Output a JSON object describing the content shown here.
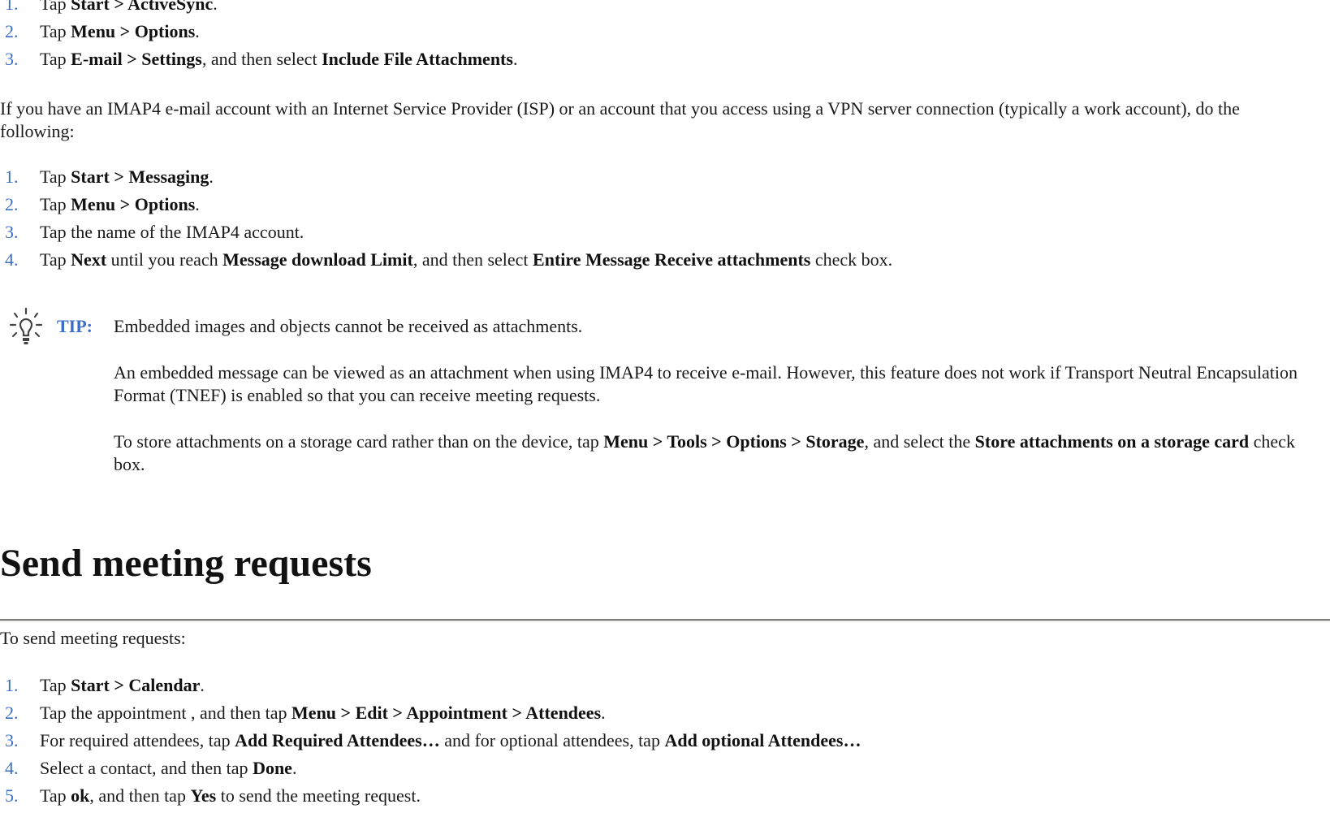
{
  "list1": [
    {
      "num": "1.",
      "parts": [
        "Tap ",
        {
          "b": "Start > ActiveSync"
        },
        "."
      ]
    },
    {
      "num": "2.",
      "parts": [
        "Tap ",
        {
          "b": "Menu > Options"
        },
        "."
      ]
    },
    {
      "num": "3.",
      "parts": [
        "Tap ",
        {
          "b": "E-mail > Settings"
        },
        ", and then select ",
        {
          "b": "Include File Attachments"
        },
        "."
      ]
    }
  ],
  "imap_intro": "If you have an IMAP4 e-mail account with an Internet Service Provider (ISP) or an account that you access using a VPN server connection (typically a work account), do the following:",
  "list2": [
    {
      "num": "1.",
      "parts": [
        "Tap ",
        {
          "b": "Start > Messaging"
        },
        "."
      ]
    },
    {
      "num": "2.",
      "parts": [
        "Tap ",
        {
          "b": "Menu > Options"
        },
        "."
      ]
    },
    {
      "num": "3.",
      "parts": [
        "Tap the name of the IMAP4 account."
      ]
    },
    {
      "num": "4.",
      "parts": [
        "Tap ",
        {
          "b": "Next"
        },
        " until you reach ",
        {
          "b": "Message download Limit"
        },
        ", and then select ",
        {
          "b": "Entire Message Receive attachments"
        },
        " check box."
      ]
    }
  ],
  "tip": {
    "icon": "lightbulb-icon",
    "label": "TIP:",
    "paragraphs": [
      [
        "Embedded images and objects cannot be received as attachments."
      ],
      [
        "An embedded message can be viewed as an attachment when using IMAP4 to receive e-mail. However, this feature does not work if Transport Neutral Encapsulation Format (TNEF) is enabled so that you can receive meeting requests."
      ],
      [
        "To store attachments on a storage card rather than on the device, tap ",
        {
          "b": "Menu > Tools > Options > Storage"
        },
        ", and select the ",
        {
          "b": "Store attachments on a storage card"
        },
        " check box."
      ]
    ]
  },
  "section": {
    "heading": "Send meeting requests",
    "intro": "To send meeting requests:",
    "steps": [
      {
        "num": "1.",
        "parts": [
          "Tap ",
          {
            "b": "Start > Calendar"
          },
          "."
        ]
      },
      {
        "num": "2.",
        "parts": [
          "Tap the appointment , and then tap ",
          {
            "b": "Menu > Edit > Appointment > Attendees"
          },
          "."
        ]
      },
      {
        "num": "3.",
        "parts": [
          "For required attendees, tap ",
          {
            "b": "Add Required Attendees…"
          },
          " and for optional attendees, tap ",
          {
            "b": "Add optional Attendees…"
          }
        ]
      },
      {
        "num": "4.",
        "parts": [
          "Select a contact, and then tap ",
          {
            "b": "Done"
          },
          "."
        ]
      },
      {
        "num": "5.",
        "parts": [
          "Tap ",
          {
            "b": "ok"
          },
          ", and then tap ",
          {
            "b": "Yes"
          },
          " to send the meeting request."
        ]
      }
    ]
  },
  "colors": {
    "list_number": "#3c6fc7",
    "tip_label": "#3c6fc7",
    "rule": "#7d7d7d"
  }
}
